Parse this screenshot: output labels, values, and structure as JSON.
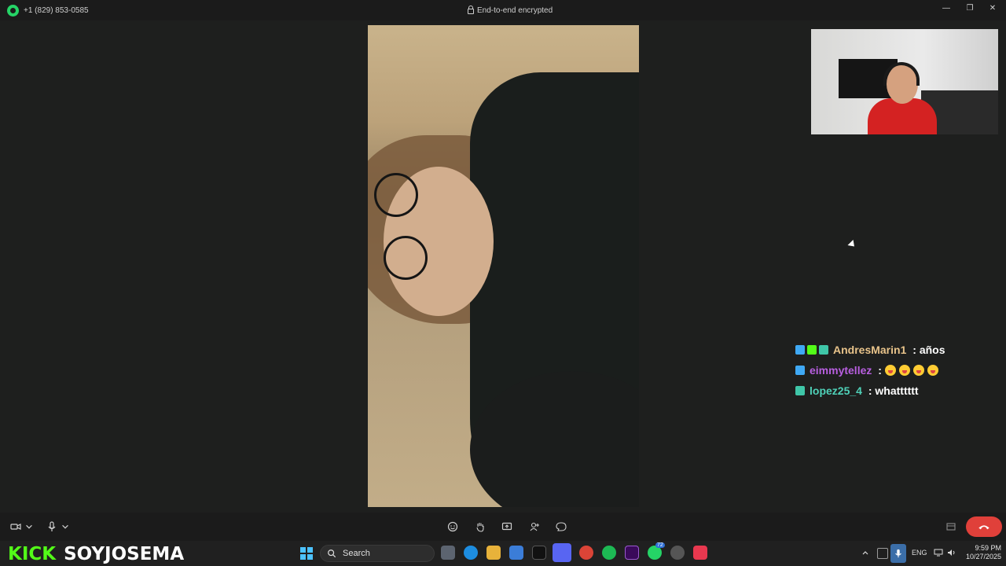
{
  "titlebar": {
    "caller_number": "+1 (829) 853-0585",
    "encryption_label": "End-to-end encrypted",
    "minimize": "—",
    "maximize": "❐",
    "close": "✕"
  },
  "chat": [
    {
      "user": "AndresMarin1",
      "separator": " : ",
      "message": "años",
      "user_color": "#e8c38a",
      "badges": [
        "#3fa9f5",
        "#53fc18",
        "#3fc6a8"
      ]
    },
    {
      "user": "eimmytellez",
      "separator": " : ",
      "message": "",
      "emojis": 4,
      "user_color": "#b85fe0",
      "badges": [
        "#3fa9f5"
      ]
    },
    {
      "user": "lopez25_4",
      "separator": " : ",
      "message": "whatttttt",
      "user_color": "#4fd1b8",
      "badges": [
        "#3fc6a8"
      ]
    }
  ],
  "overlay": {
    "kick_logo": "KICK",
    "channel": "SOYJOSEMA",
    "logo_color": "#53fc18"
  },
  "taskbar": {
    "search_label": "Search",
    "language": "ENG",
    "time": "9:59 PM",
    "date": "10/27/2025",
    "whatsapp_badge": "72"
  },
  "colors": {
    "end_call": "#e0403a",
    "whatsapp": "#25d366",
    "start": "#4cc2ff"
  }
}
